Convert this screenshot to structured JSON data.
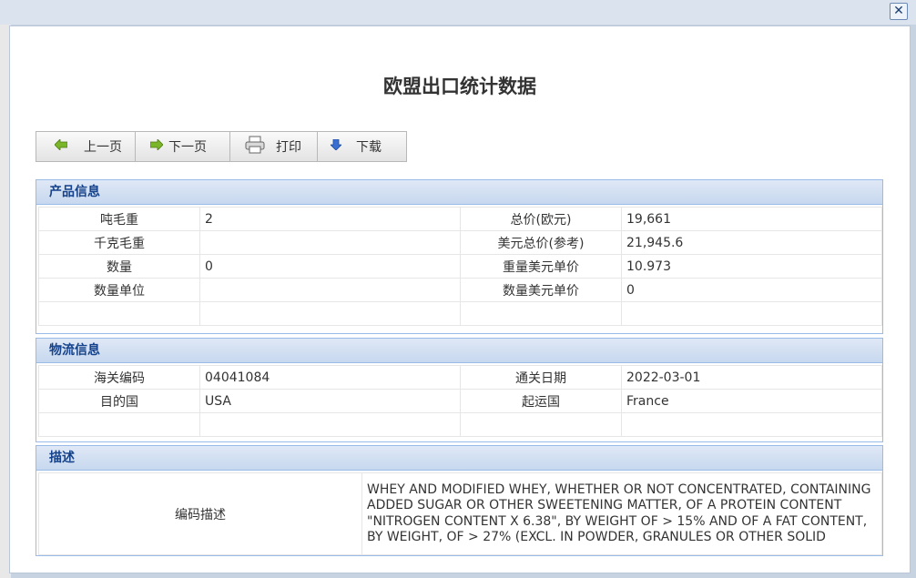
{
  "window": {
    "close_label": "✕"
  },
  "title": "欧盟出口统计数据",
  "toolbar": {
    "prev": "上一页",
    "next": "下一页",
    "print": "打印",
    "download": "下载"
  },
  "product": {
    "header": "产品信息",
    "rows": [
      {
        "l1": "吨毛重",
        "v1": "2",
        "l2": "总价(欧元)",
        "v2": "19,661"
      },
      {
        "l1": "千克毛重",
        "v1": "",
        "l2": "美元总价(参考)",
        "v2": "21,945.6"
      },
      {
        "l1": "数量",
        "v1": "0",
        "l2": "重量美元单价",
        "v2": "10.973"
      },
      {
        "l1": "数量单位",
        "v1": "",
        "l2": "数量美元单价",
        "v2": "0"
      }
    ]
  },
  "logistics": {
    "header": "物流信息",
    "rows": [
      {
        "l1": "海关编码",
        "v1": "04041084",
        "l2": "通关日期",
        "v2": "2022-03-01"
      },
      {
        "l1": "目的国",
        "v1": "USA",
        "l2": "起运国",
        "v2": "France"
      }
    ]
  },
  "description": {
    "header": "描述",
    "label": "编码描述",
    "text": "WHEY AND MODIFIED WHEY, WHETHER OR NOT CONCENTRATED, CONTAINING ADDED SUGAR OR OTHER SWEETENING MATTER, OF A PROTEIN CONTENT \"NITROGEN CONTENT X 6.38\", BY WEIGHT OF > 15% AND OF A FAT CONTENT, BY WEIGHT, OF > 27% (EXCL. IN POWDER, GRANULES OR OTHER SOLID"
  },
  "colors": {
    "section_header_text": "#15428b",
    "section_border": "#99bbe8",
    "prev_icon": "#7bb52a",
    "download_icon": "#3a6fd1"
  },
  "icons": {
    "prev": "arrow-left-icon",
    "next": "arrow-right-icon",
    "print": "printer-icon",
    "download": "arrow-down-icon"
  }
}
